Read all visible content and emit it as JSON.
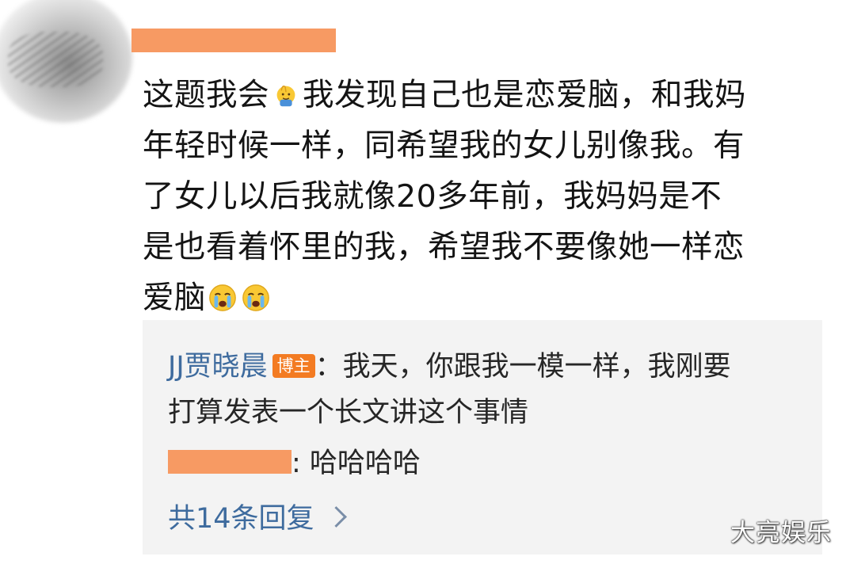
{
  "comment": {
    "lines": [
      {
        "before_emoji": "这题我会",
        "after_emoji": "我发现自己也是恋爱脑，和我妈"
      },
      "年轻时候一样，同希望我的女儿别像我。有",
      "了女儿以后我就像20多年前，我妈妈是不",
      "是也看着怀里的我，希望我不要像她一样恋",
      {
        "before_emoji": "爱脑"
      }
    ],
    "inline_emoji": "raising-hand-emoji",
    "trailing_emojis": [
      "crying-face-emoji",
      "crying-face-emoji"
    ]
  },
  "replies": [
    {
      "user": "JJ贾晓晨",
      "badge": "博主",
      "text_line1": "：我天，你跟我一模一样，我刚要",
      "text_line2": "打算发表一个长文讲这个事情"
    },
    {
      "text": ": 哈哈哈哈"
    }
  ],
  "more_replies_label": "共14条回复",
  "watermark": "大亮娱乐",
  "colors": {
    "link_blue": "#3e6b9e",
    "badge_orange": "#f37b22",
    "redaction_orange": "#f79a63",
    "reply_bg": "#f3f3f3"
  }
}
